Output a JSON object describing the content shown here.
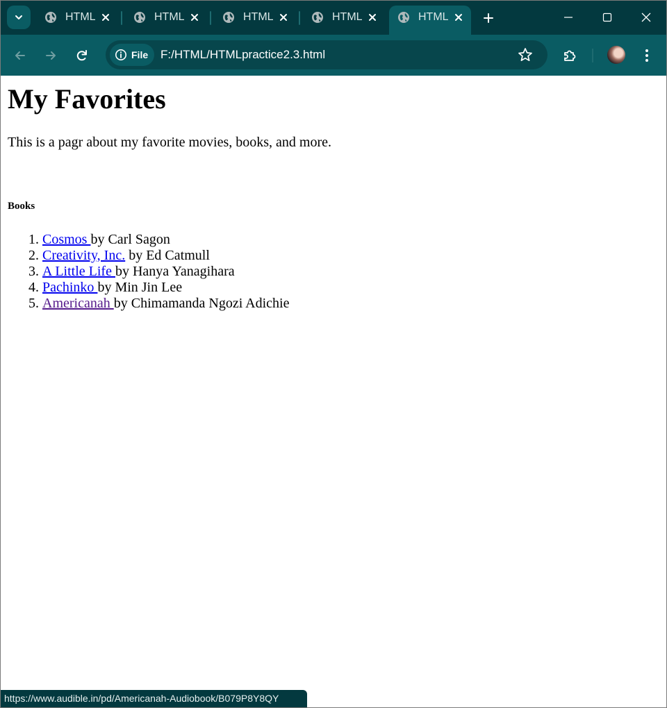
{
  "browser": {
    "tabs": [
      {
        "title": "HTML",
        "active": false
      },
      {
        "title": "HTML",
        "active": false
      },
      {
        "title": "HTML",
        "active": false
      },
      {
        "title": "HTML",
        "active": false
      },
      {
        "title": "HTML",
        "active": true
      }
    ],
    "address": {
      "chip_label": "File",
      "url": "F:/HTML/HTMLpractice2.3.html"
    },
    "status_url": "https://www.audible.in/pd/Americanah-Audiobook/B079P8Y8QY",
    "theme": {
      "frame": "#03393f",
      "toolbar": "#0a5c63",
      "omnibox": "#07464c"
    }
  },
  "page": {
    "heading": "My Favorites",
    "intro": "This is a pagr about my favorite movies, books, and more.",
    "section_title": "Books",
    "books": [
      {
        "title": "Cosmos ",
        "author": "by Carl Sagon",
        "visited": false
      },
      {
        "title": "Creativity, Inc.",
        "author": " by Ed Catmull",
        "visited": false
      },
      {
        "title": "A Little Life ",
        "author": "by Hanya Yanagihara",
        "visited": false
      },
      {
        "title": "Pachinko ",
        "author": "by Min Jin Lee",
        "visited": false
      },
      {
        "title": "Americanah ",
        "author": "by Chimamanda Ngozi Adichie",
        "visited": true
      }
    ]
  }
}
